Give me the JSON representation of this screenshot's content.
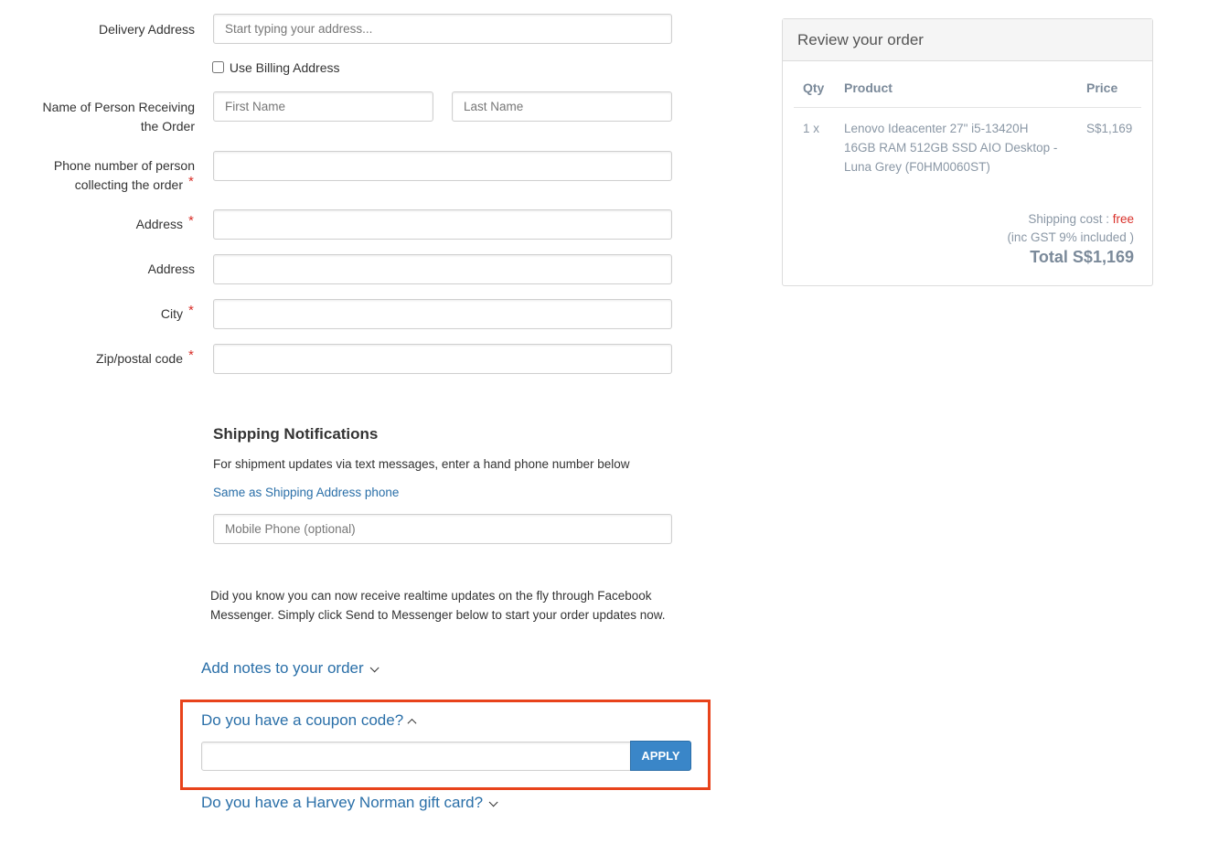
{
  "form": {
    "delivery_address_label": "Delivery Address",
    "delivery_address_placeholder": "Start typing your address...",
    "use_billing_label": "Use Billing Address",
    "name_label_line1": "Name of Person Receiving",
    "name_label_line2": "the Order",
    "first_name_placeholder": "First Name",
    "last_name_placeholder": "Last Name",
    "phone_label_line1": "Phone number of person",
    "phone_label_line2": "collecting the order",
    "address1_label": "Address",
    "address2_label": "Address",
    "city_label": "City",
    "zip_label": "Zip/postal code",
    "required_mark": "*"
  },
  "shipping_notifications": {
    "heading": "Shipping Notifications",
    "description": "For shipment updates via text messages, enter a hand phone number below",
    "same_as_link": "Same as Shipping Address phone",
    "mobile_placeholder": "Mobile Phone (optional)"
  },
  "messenger": {
    "line1": "Did you know you can now receive realtime updates on the fly through Facebook",
    "line2": "Messenger. Simply click Send to Messenger below to start your order updates now."
  },
  "extras": {
    "notes_link": "Add notes to your order",
    "coupon_link": "Do you have a coupon code?",
    "coupon_value": "",
    "apply_label": "APPLY",
    "gift_card_link": "Do you have a Harvey Norman gift card?"
  },
  "review": {
    "title": "Review your order",
    "headers": {
      "qty": "Qty",
      "product": "Product",
      "price": "Price"
    },
    "items": [
      {
        "qty": "1 x",
        "product_line1": "Lenovo Ideacenter 27\" i5-13420H",
        "product_line2": "16GB RAM 512GB SSD AIO Desktop -",
        "product_line3": "Luna Grey (F0HM0060ST)",
        "price": "S$1,169"
      }
    ],
    "shipping_label": "Shipping cost :",
    "shipping_value": "free",
    "gst_note": "(inc GST 9% included )",
    "total": "Total S$1,169"
  },
  "colors": {
    "link": "#2a6fa8",
    "apply_button": "#3a86c8",
    "highlight_border": "#e8431b",
    "required": "#d9302a"
  }
}
